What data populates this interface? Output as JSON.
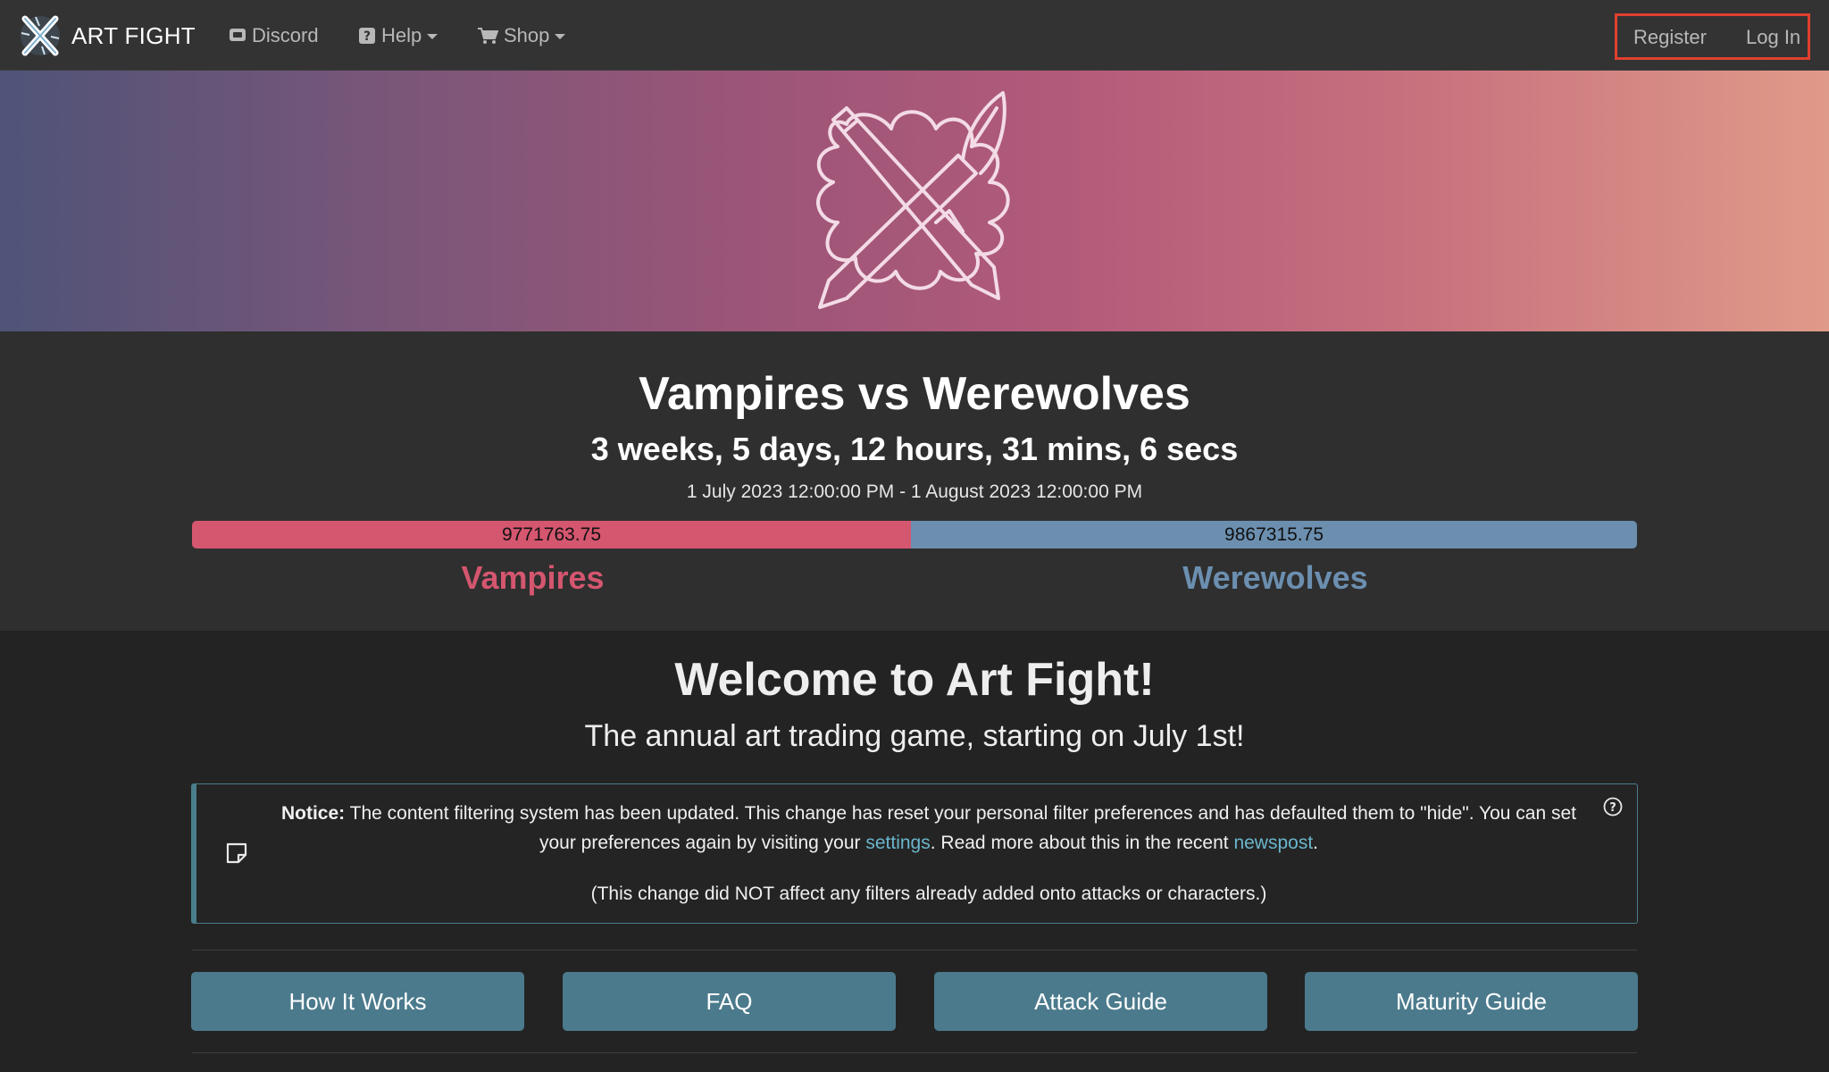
{
  "nav": {
    "brand": "ART FIGHT",
    "discord": "Discord",
    "help": "Help",
    "shop": "Shop",
    "register": "Register",
    "login": "Log In"
  },
  "event": {
    "title": "Vampires vs Werewolves",
    "countdown": "3 weeks, 5 days, 12 hours, 31 mins, 6 secs",
    "date_range": "1 July 2023 12:00:00 PM - 1 August 2023 12:00:00 PM",
    "teams": [
      {
        "name": "Vampires",
        "score": "9771763.75",
        "color": "#d4566f"
      },
      {
        "name": "Werewolves",
        "score": "9867315.75",
        "color": "#6c8fb0"
      }
    ]
  },
  "welcome": {
    "title": "Welcome to Art Fight!",
    "subtitle": "The annual art trading game, starting on July 1st!"
  },
  "notice": {
    "label": "Notice:",
    "text_a": " The content filtering system has been updated. This change has reset your personal filter preferences and has defaulted them to \"hide\". You can set your preferences again by visiting your ",
    "settings_link": "settings",
    "text_b": ". Read more about this in the recent ",
    "newspost_link": "newspost",
    "text_c": ".",
    "footnote": "(This change did NOT affect any filters already added onto attacks or characters.)"
  },
  "buttons": [
    "How It Works",
    "FAQ",
    "Attack Guide",
    "Maturity Guide"
  ],
  "colors": {
    "navbar": "#333333",
    "vampires": "#d4566f",
    "werewolves": "#6c8fb0",
    "button": "#4b7a8c",
    "highlight_box": "#e0402e"
  }
}
